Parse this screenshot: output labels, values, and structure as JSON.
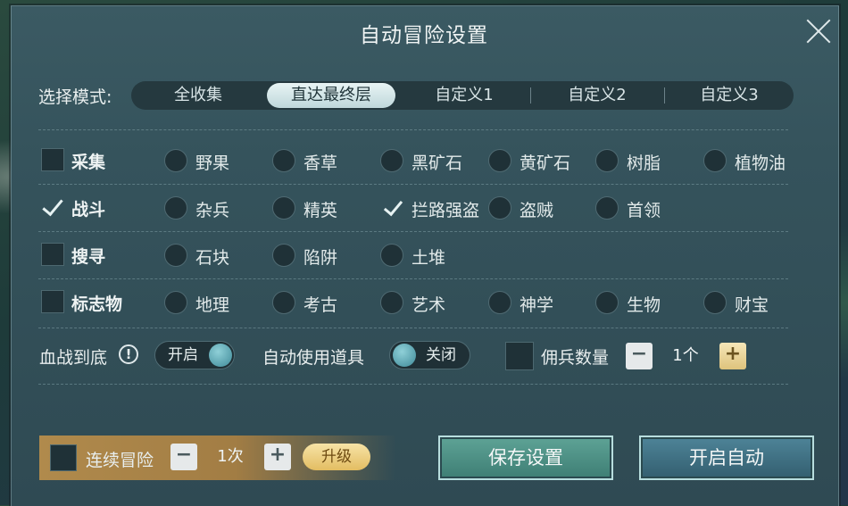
{
  "dialog": {
    "title": "自动冒险设置",
    "close_icon": "close-icon"
  },
  "mode": {
    "label": "选择模式:",
    "tabs": [
      "全收集",
      "直达最终层",
      "自定义1",
      "自定义2",
      "自定义3"
    ],
    "active_index": 1
  },
  "categories": [
    {
      "label": "采集",
      "checked": false,
      "options": [
        {
          "label": "野果",
          "checked": false
        },
        {
          "label": "香草",
          "checked": false
        },
        {
          "label": "黑矿石",
          "checked": false
        },
        {
          "label": "黄矿石",
          "checked": false
        },
        {
          "label": "树脂",
          "checked": false
        },
        {
          "label": "植物油",
          "checked": false
        }
      ]
    },
    {
      "label": "战斗",
      "checked": true,
      "options": [
        {
          "label": "杂兵",
          "checked": false
        },
        {
          "label": "精英",
          "checked": false
        },
        {
          "label": "拦路强盗",
          "checked": true
        },
        {
          "label": "盗贼",
          "checked": false
        },
        {
          "label": "首领",
          "checked": false
        }
      ]
    },
    {
      "label": "搜寻",
      "checked": false,
      "options": [
        {
          "label": "石块",
          "checked": false
        },
        {
          "label": "陷阱",
          "checked": false
        },
        {
          "label": "土堆",
          "checked": false
        }
      ]
    },
    {
      "label": "标志物",
      "checked": false,
      "options": [
        {
          "label": "地理",
          "checked": false
        },
        {
          "label": "考古",
          "checked": false
        },
        {
          "label": "艺术",
          "checked": false
        },
        {
          "label": "神学",
          "checked": false
        },
        {
          "label": "生物",
          "checked": false
        },
        {
          "label": "财宝",
          "checked": false
        }
      ]
    }
  ],
  "settings": {
    "fight_to_end": {
      "label": "血战到底",
      "info_icon": "!",
      "toggle_label": "开启",
      "on": true
    },
    "auto_items": {
      "label": "自动使用道具",
      "toggle_label": "关闭",
      "on": false
    },
    "mercenary": {
      "label": "佣兵数量",
      "checked": false,
      "minus": "−",
      "value": "1个",
      "plus": "+"
    }
  },
  "footer": {
    "continuous": {
      "label": "连续冒险",
      "checked": false,
      "minus": "−",
      "value": "1次",
      "plus": "+",
      "upgrade": "升级"
    },
    "save_label": "保存设置",
    "auto_label": "开启自动"
  },
  "colors": {
    "accent_yellow": "#e3bd62",
    "save_green": "#4e9286",
    "auto_blue": "#41728a"
  }
}
